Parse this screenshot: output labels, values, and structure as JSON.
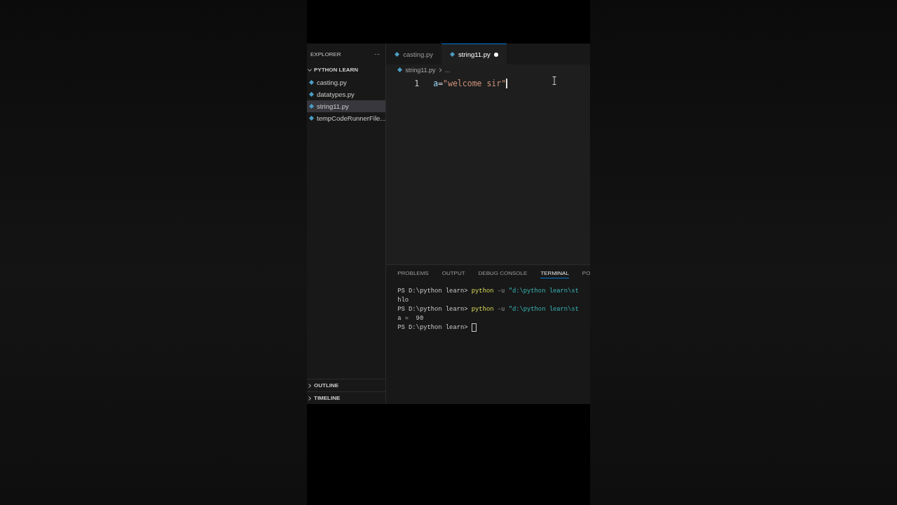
{
  "explorer": {
    "title": "EXPLORER",
    "more": "···",
    "folder": {
      "name": "PYTHON LEARN",
      "expanded": true
    },
    "files": [
      {
        "name": "casting.py",
        "selected": false
      },
      {
        "name": "datatypes.py",
        "selected": false
      },
      {
        "name": "string11.py",
        "selected": true
      },
      {
        "name": "tempCodeRunnerFile...",
        "selected": false
      }
    ],
    "sections": [
      {
        "name": "OUTLINE",
        "expanded": false
      },
      {
        "name": "TIMELINE",
        "expanded": false
      }
    ]
  },
  "tabs": [
    {
      "label": "casting.py",
      "selected": false,
      "modified": false
    },
    {
      "label": "string11.py",
      "selected": true,
      "modified": true
    }
  ],
  "breadcrumb": {
    "file": "string11.py",
    "rest": "..."
  },
  "code": [
    {
      "number": "1",
      "tokens": [
        {
          "kind": "variable",
          "text": "a"
        },
        {
          "kind": "operator",
          "text": "="
        },
        {
          "kind": "string",
          "text": "\"welcome sir\""
        }
      ]
    }
  ],
  "panel_tabs": [
    {
      "label": "PROBLEMS",
      "selected": false
    },
    {
      "label": "OUTPUT",
      "selected": false
    },
    {
      "label": "DEBUG CONSOLE",
      "selected": false
    },
    {
      "label": "TERMINAL",
      "selected": true
    },
    {
      "label": "PO",
      "selected": false
    }
  ],
  "terminal": [
    [
      {
        "kind": "prompt",
        "text": "PS D:\\python learn> "
      },
      {
        "kind": "command",
        "text": "python"
      },
      {
        "kind": "flag",
        "text": " -u "
      },
      {
        "kind": "string",
        "text": "\"d:\\python learn\\st"
      }
    ],
    [
      {
        "kind": "output",
        "text": "hlo"
      }
    ],
    [
      {
        "kind": "prompt",
        "text": "PS D:\\python learn> "
      },
      {
        "kind": "command",
        "text": "python"
      },
      {
        "kind": "flag",
        "text": " -u "
      },
      {
        "kind": "string",
        "text": "\"d:\\python learn\\st"
      }
    ],
    [
      {
        "kind": "output",
        "text": "a =  90"
      }
    ],
    [
      {
        "kind": "prompt",
        "text": "PS D:\\python learn> "
      },
      {
        "kind": "cursor"
      }
    ]
  ]
}
